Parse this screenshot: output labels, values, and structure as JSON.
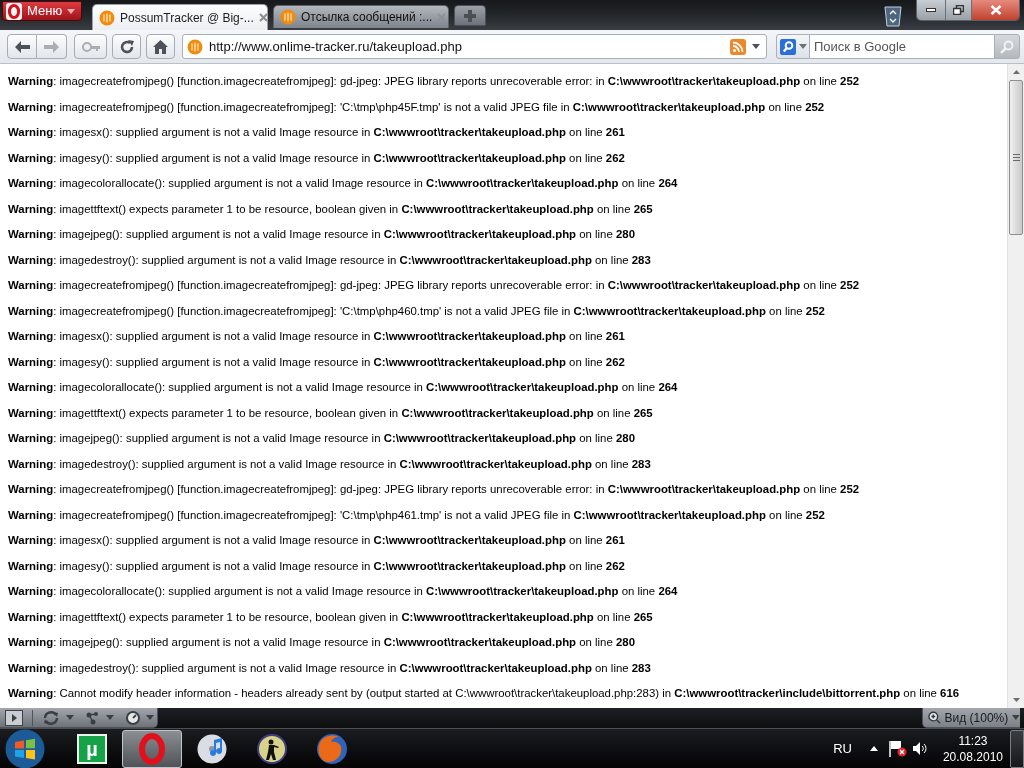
{
  "browser": {
    "menu_button": "Меню",
    "tabs": [
      {
        "title": "PossumTracker @ Big-...",
        "selected": true
      },
      {
        "title": "Отсылка сообщений :...",
        "selected": false
      }
    ],
    "navigation": [
      {
        "kind": "back",
        "disabled": false
      },
      {
        "kind": "forward",
        "disabled": true
      },
      {
        "kind": "key",
        "disabled": true
      },
      {
        "kind": "reload",
        "disabled": false
      },
      {
        "kind": "home",
        "disabled": false
      }
    ],
    "address": "http://www.onlime-tracker.ru/takeupload.php",
    "search": {
      "placeholder": "Поиск в Google"
    }
  },
  "page": {
    "warnings": [
      "**Warning**: imagecreatefromjpeg() [function.imagecreatefromjpeg]: gd-jpeg: JPEG library reports unrecoverable error: in **C:\\wwwroot\\tracker\\takeupload.php** on line **252**",
      "**Warning**: imagecreatefromjpeg() [function.imagecreatefromjpeg]: 'C:\\tmp\\php45F.tmp' is not a valid JPEG file in **C:\\wwwroot\\tracker\\takeupload.php** on line **252**",
      "**Warning**: imagesx(): supplied argument is not a valid Image resource in **C:\\wwwroot\\tracker\\takeupload.php** on line **261**",
      "**Warning**: imagesy(): supplied argument is not a valid Image resource in **C:\\wwwroot\\tracker\\takeupload.php** on line **262**",
      "**Warning**: imagecolorallocate(): supplied argument is not a valid Image resource in **C:\\wwwroot\\tracker\\takeupload.php** on line **264**",
      "**Warning**: imagettftext() expects parameter 1 to be resource, boolean given in **C:\\wwwroot\\tracker\\takeupload.php** on line **265**",
      "**Warning**: imagejpeg(): supplied argument is not a valid Image resource in **C:\\wwwroot\\tracker\\takeupload.php** on line **280**",
      "**Warning**: imagedestroy(): supplied argument is not a valid Image resource in **C:\\wwwroot\\tracker\\takeupload.php** on line **283**",
      "**Warning**: imagecreatefromjpeg() [function.imagecreatefromjpeg]: gd-jpeg: JPEG library reports unrecoverable error: in **C:\\wwwroot\\tracker\\takeupload.php** on line **252**",
      "**Warning**: imagecreatefromjpeg() [function.imagecreatefromjpeg]: 'C:\\tmp\\php460.tmp' is not a valid JPEG file in **C:\\wwwroot\\tracker\\takeupload.php** on line **252**",
      "**Warning**: imagesx(): supplied argument is not a valid Image resource in **C:\\wwwroot\\tracker\\takeupload.php** on line **261**",
      "**Warning**: imagesy(): supplied argument is not a valid Image resource in **C:\\wwwroot\\tracker\\takeupload.php** on line **262**",
      "**Warning**: imagecolorallocate(): supplied argument is not a valid Image resource in **C:\\wwwroot\\tracker\\takeupload.php** on line **264**",
      "**Warning**: imagettftext() expects parameter 1 to be resource, boolean given in **C:\\wwwroot\\tracker\\takeupload.php** on line **265**",
      "**Warning**: imagejpeg(): supplied argument is not a valid Image resource in **C:\\wwwroot\\tracker\\takeupload.php** on line **280**",
      "**Warning**: imagedestroy(): supplied argument is not a valid Image resource in **C:\\wwwroot\\tracker\\takeupload.php** on line **283**",
      "**Warning**: imagecreatefromjpeg() [function.imagecreatefromjpeg]: gd-jpeg: JPEG library reports unrecoverable error: in **C:\\wwwroot\\tracker\\takeupload.php** on line **252**",
      "**Warning**: imagecreatefromjpeg() [function.imagecreatefromjpeg]: 'C:\\tmp\\php461.tmp' is not a valid JPEG file in **C:\\wwwroot\\tracker\\takeupload.php** on line **252**",
      "**Warning**: imagesx(): supplied argument is not a valid Image resource in **C:\\wwwroot\\tracker\\takeupload.php** on line **261**",
      "**Warning**: imagesy(): supplied argument is not a valid Image resource in **C:\\wwwroot\\tracker\\takeupload.php** on line **262**",
      "**Warning**: imagecolorallocate(): supplied argument is not a valid Image resource in **C:\\wwwroot\\tracker\\takeupload.php** on line **264**",
      "**Warning**: imagettftext() expects parameter 1 to be resource, boolean given in **C:\\wwwroot\\tracker\\takeupload.php** on line **265**",
      "**Warning**: imagejpeg(): supplied argument is not a valid Image resource in **C:\\wwwroot\\tracker\\takeupload.php** on line **280**",
      "**Warning**: imagedestroy(): supplied argument is not a valid Image resource in **C:\\wwwroot\\tracker\\takeupload.php** on line **283**",
      "**Warning**: Cannot modify header information - headers already sent by (output started at C:\\wwwroot\\tracker\\takeupload.php:283) in **C:\\wwwroot\\tracker\\include\\bittorrent.php** on line **616**"
    ]
  },
  "status_bar": {
    "zoom": "Вид (100%)"
  },
  "taskbar": {
    "apps": [
      {
        "kind": "mu-tile",
        "glyph": "µ",
        "selected": false
      },
      {
        "kind": "ring",
        "selected": true
      },
      {
        "kind": "disc",
        "selected": false
      },
      {
        "kind": "emblem",
        "selected": false
      },
      {
        "kind": "globe",
        "selected": false
      }
    ],
    "tray": {
      "language": "RU",
      "time": "11:23",
      "date": "20.08.2010"
    }
  }
}
